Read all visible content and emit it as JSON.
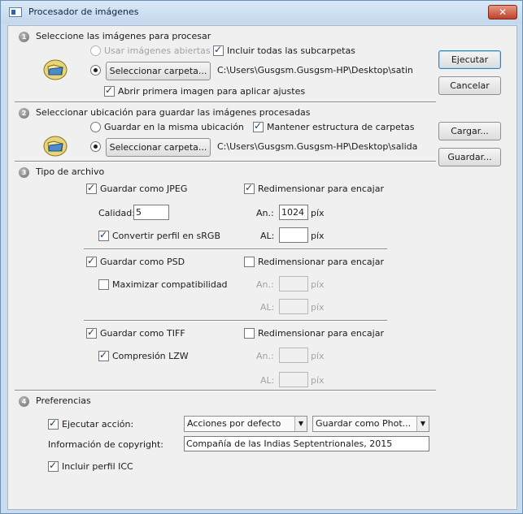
{
  "window": {
    "title": "Procesador de imágenes",
    "close_label": "✕"
  },
  "steps": [
    "1",
    "2",
    "3",
    "4"
  ],
  "section1": {
    "title": "Seleccione las imágenes para procesar",
    "use_open_images": "Usar imágenes abiertas",
    "include_subfolders": "Incluir todas las subcarpetas",
    "select_folder_btn": "Seleccionar carpeta...",
    "folder_path": "C:\\Users\\Gusgsm.Gusgsm-HP\\Desktop\\satin",
    "open_first_image": "Abrir primera imagen para aplicar ajustes"
  },
  "section2": {
    "title": "Seleccionar ubicación para guardar las imágenes procesadas",
    "save_same_location": "Guardar en la misma ubicación",
    "keep_folder_structure": "Mantener estructura de carpetas",
    "select_folder_btn": "Seleccionar carpeta...",
    "folder_path": "C:\\Users\\Gusgsm.Gusgsm-HP\\Desktop\\salida"
  },
  "section3": {
    "title": "Tipo de archivo",
    "jpeg": {
      "save_label": "Guardar como JPEG",
      "resize_label": "Redimensionar para encajar",
      "quality_label": "Calidad:",
      "quality_value": "5",
      "width_label": "An.:",
      "width_value": "1024",
      "width_unit": "píx",
      "convert_srgb": "Convertir perfil en sRGB",
      "height_label": "AL:",
      "height_value": "",
      "height_unit": "píx"
    },
    "psd": {
      "save_label": "Guardar como PSD",
      "resize_label": "Redimensionar para encajar",
      "maximize_compat": "Maximizar compatibilidad",
      "width_label": "An.:",
      "width_unit": "píx",
      "height_label": "AL:",
      "height_unit": "píx"
    },
    "tiff": {
      "save_label": "Guardar como TIFF",
      "resize_label": "Redimensionar para encajar",
      "lzw": "Compresión LZW",
      "width_label": "An.:",
      "width_unit": "píx",
      "height_label": "AL:",
      "height_unit": "píx"
    }
  },
  "section4": {
    "title": "Preferencias",
    "run_action": "Ejecutar acción:",
    "action_set": "Acciones por defecto",
    "action_name": "Guardar como Phot...",
    "copyright_label": "Información de copyright:",
    "copyright_value": "Compañía de las Indias Septentrionales, 2015",
    "include_icc": "Incluir perfil ICC"
  },
  "buttons": {
    "run": "Ejecutar",
    "cancel": "Cancelar",
    "load": "Cargar...",
    "save": "Guardar..."
  }
}
